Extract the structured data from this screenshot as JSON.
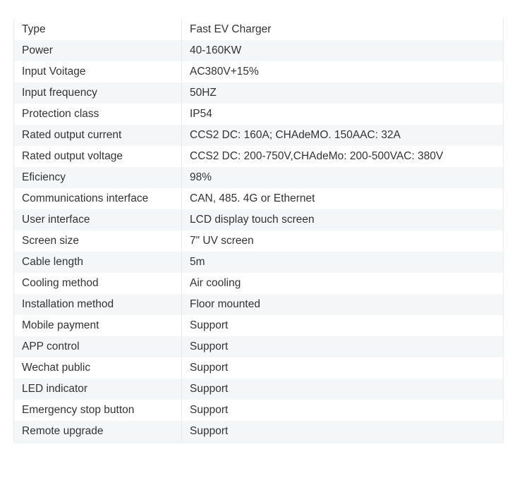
{
  "table": {
    "rows": [
      {
        "label": "Type",
        "value": "Fast EV Charger"
      },
      {
        "label": "Power",
        "value": "40-160KW"
      },
      {
        "label": "Input Voitage",
        "value": "AC380V+15%"
      },
      {
        "label": "Input frequency",
        "value": "50HZ"
      },
      {
        "label": "Protection class",
        "value": "IP54"
      },
      {
        "label": "Rated output current",
        "value": "CCS2 DC: 160A; CHAdeMO. 150AAC: 32A"
      },
      {
        "label": "Rated output voltage",
        "value": "CCS2 DC: 200-750V,CHAdeMo: 200-500VAC: 380V"
      },
      {
        "label": "Eficiency",
        "value": "98%"
      },
      {
        "label": "Communications interface",
        "value": "CAN, 485. 4G or Ethernet"
      },
      {
        "label": "User interface",
        "value": "LCD display touch screen"
      },
      {
        "label": "Screen size",
        "value": "7\" UV screen"
      },
      {
        "label": "Cable length",
        "value": "5m"
      },
      {
        "label": "Cooling method",
        "value": "Air cooling"
      },
      {
        "label": "Installation method",
        "value": "Floor mounted"
      },
      {
        "label": "Mobile payment",
        "value": "Support"
      },
      {
        "label": "APP control",
        "value": "Support"
      },
      {
        "label": "Wechat public",
        "value": "Support"
      },
      {
        "label": "LED indicator",
        "value": "Support"
      },
      {
        "label": "Emergency stop button",
        "value": "Support"
      },
      {
        "label": "Remote upgrade",
        "value": "Support"
      }
    ]
  },
  "colors": {
    "row_stripe": "#f5f6f8",
    "row_base": "#ffffff",
    "border": "#e8ebef",
    "text": "#333333",
    "page_background": "#ffffff"
  }
}
